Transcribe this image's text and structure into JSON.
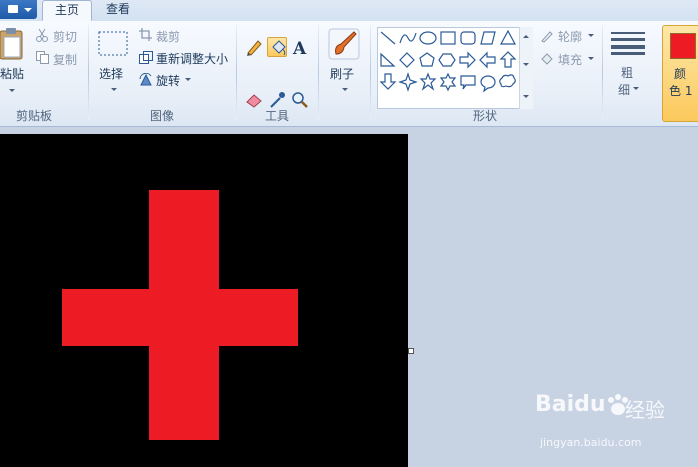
{
  "tabs": {
    "home": "主页",
    "view": "查看"
  },
  "clipboard": {
    "paste": "粘贴",
    "cut": "剪切",
    "copy": "复制",
    "group": "剪贴板"
  },
  "image": {
    "select": "选择",
    "crop": "裁剪",
    "resize": "重新调整大小",
    "rotate": "旋转",
    "group": "图像"
  },
  "tools": {
    "group": "工具"
  },
  "brushes": {
    "label": "刷子"
  },
  "shapes": {
    "outline": "轮廓",
    "fill": "填充",
    "group": "形状"
  },
  "size": {
    "label_1": "粗",
    "label_2": "细"
  },
  "color": {
    "label_1": "颜",
    "label_2": "色 1",
    "value": "#ed1c24"
  },
  "watermark": {
    "brand": "Baidu",
    "brand_cn": "经验",
    "url": "jingyan.baidu.com"
  }
}
